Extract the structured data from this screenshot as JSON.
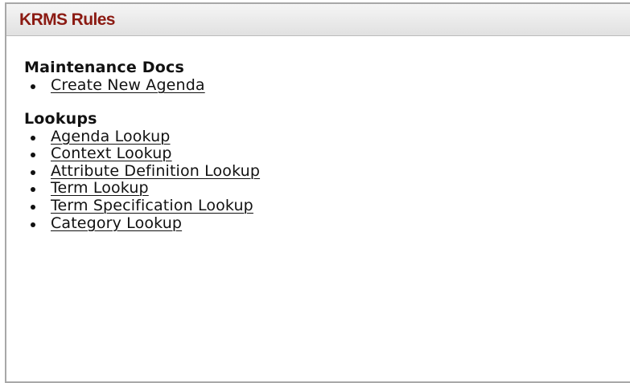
{
  "panel": {
    "title": "KRMS Rules"
  },
  "maintenance_docs": {
    "heading": "Maintenance Docs",
    "links": [
      {
        "label": "Create New Agenda"
      }
    ]
  },
  "lookups": {
    "heading": "Lookups",
    "links": [
      {
        "label": "Agenda Lookup"
      },
      {
        "label": "Context Lookup"
      },
      {
        "label": "Attribute Definition Lookup"
      },
      {
        "label": "Term Lookup"
      },
      {
        "label": "Term Specification Lookup"
      },
      {
        "label": "Category Lookup"
      }
    ]
  },
  "colors": {
    "title_color": "#8b1a12",
    "text_color": "#111111",
    "border_color": "#a8a8a8"
  }
}
